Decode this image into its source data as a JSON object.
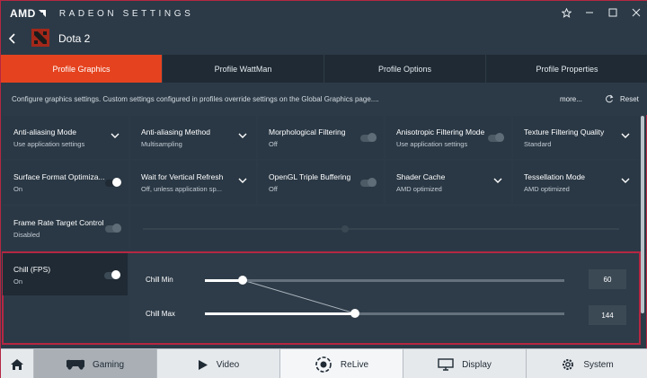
{
  "app": {
    "brand": "AMD",
    "title": "RADEON SETTINGS"
  },
  "window_controls": [
    "star-icon",
    "minimize-icon",
    "maximize-icon",
    "close-icon"
  ],
  "game": {
    "name": "Dota 2"
  },
  "tabs": [
    {
      "label": "Profile Graphics",
      "active": true
    },
    {
      "label": "Profile WattMan",
      "active": false
    },
    {
      "label": "Profile Options",
      "active": false
    },
    {
      "label": "Profile Properties",
      "active": false
    }
  ],
  "info": {
    "text": "Configure graphics settings. Custom settings configured in profiles override settings on the Global Graphics page....",
    "more": "more...",
    "reset": "Reset"
  },
  "settings": [
    {
      "title": "Anti-aliasing Mode",
      "value": "Use application settings",
      "control": "dropdown"
    },
    {
      "title": "Anti-aliasing Method",
      "value": "Multisampling",
      "control": "dropdown"
    },
    {
      "title": "Morphological Filtering",
      "value": "Off",
      "control": "toggle",
      "on": false
    },
    {
      "title": "Anisotropic Filtering Mode",
      "value": "Use application settings",
      "control": "toggle",
      "on": false
    },
    {
      "title": "Texture Filtering Quality",
      "value": "Standard",
      "control": "dropdown"
    },
    {
      "title": "Surface Format Optimiza...",
      "value": "On",
      "control": "toggle",
      "on": true
    },
    {
      "title": "Wait for Vertical Refresh",
      "value": "Off, unless application sp...",
      "control": "dropdown"
    },
    {
      "title": "OpenGL Triple Buffering",
      "value": "Off",
      "control": "toggle",
      "on": false
    },
    {
      "title": "Shader Cache",
      "value": "AMD optimized",
      "control": "dropdown"
    },
    {
      "title": "Tessellation Mode",
      "value": "AMD optimized",
      "control": "dropdown"
    },
    {
      "title": "Frame Rate Target Control",
      "value": "Disabled",
      "control": "toggle",
      "on": false
    }
  ],
  "chill": {
    "title": "Chill (FPS)",
    "value": "On",
    "on": true,
    "sliders": [
      {
        "label": "Chill Min",
        "value": "60"
      },
      {
        "label": "Chill Max",
        "value": "144"
      }
    ]
  },
  "bottom_nav": [
    {
      "label": "",
      "icon": "home-icon",
      "active": false
    },
    {
      "label": "Gaming",
      "icon": "gamepad-icon",
      "active": true
    },
    {
      "label": "Video",
      "icon": "play-icon",
      "active": false
    },
    {
      "label": "ReLive",
      "icon": "relive-icon",
      "active": false
    },
    {
      "label": "Display",
      "icon": "monitor-icon",
      "active": false
    },
    {
      "label": "System",
      "icon": "gear-icon",
      "active": false
    }
  ],
  "colors": {
    "accent": "#e5431f",
    "highlight_border": "#b52742",
    "background": "#2c3a47"
  }
}
